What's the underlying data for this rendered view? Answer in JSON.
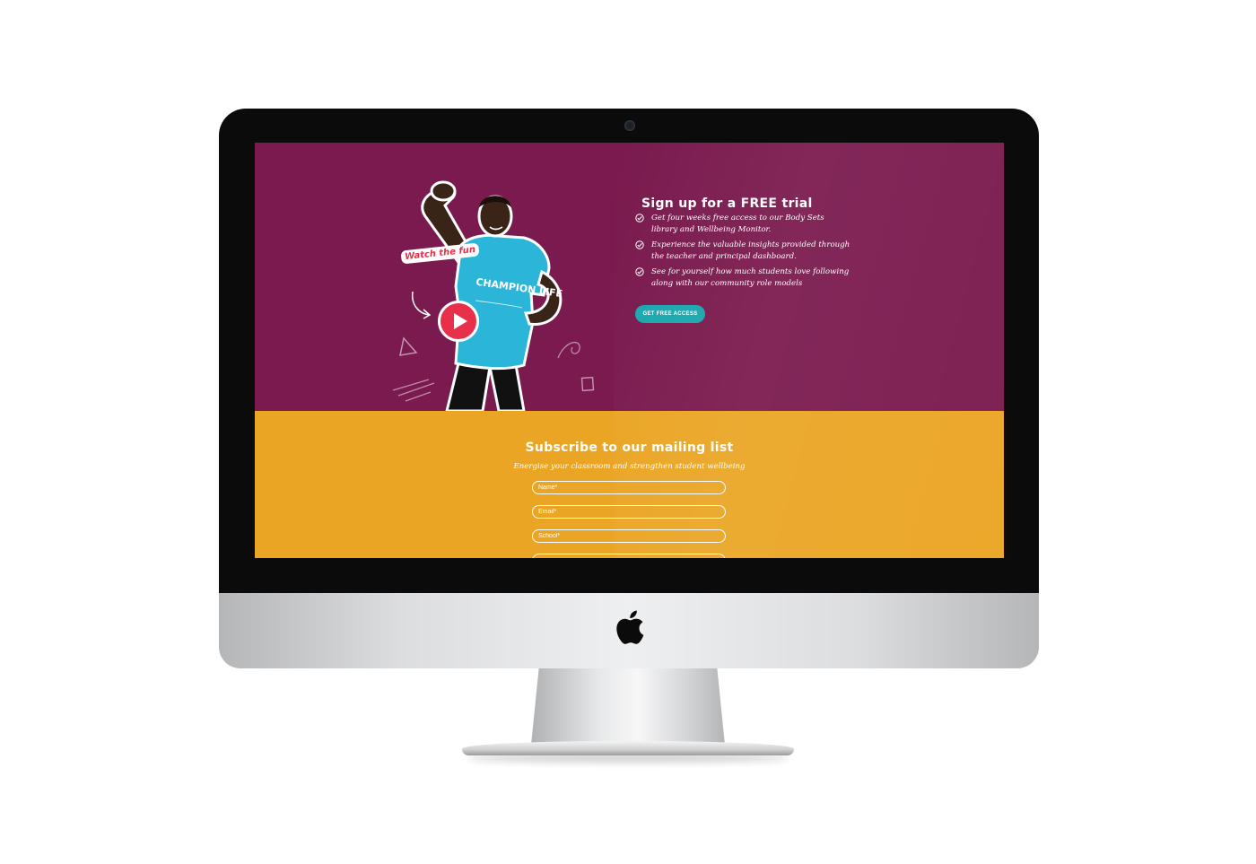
{
  "hero": {
    "title": "Sign up for a FREE trial",
    "benefits": [
      "Get four weeks free access to our Body Sets library and Wellbeing Monitor.",
      "Experience the valuable insights provided through the teacher and principal dashboard.",
      "See for yourself how much students love following along with our community role models"
    ],
    "cta_label": "GET FREE ACCESS",
    "video_sticker": "Watch the fun",
    "shirt_text": "CHAMPION LIFE",
    "background_color": "#7a1a4e",
    "button_color": "#19a7ae"
  },
  "subscribe": {
    "title": "Subscribe to our mailing list",
    "subtitle": "Energise your classroom and strengthen student wellbeing",
    "fields": {
      "name_placeholder": "Name*",
      "email_placeholder": "Email*",
      "school_placeholder": "School*"
    },
    "background_color": "#eaa524"
  }
}
